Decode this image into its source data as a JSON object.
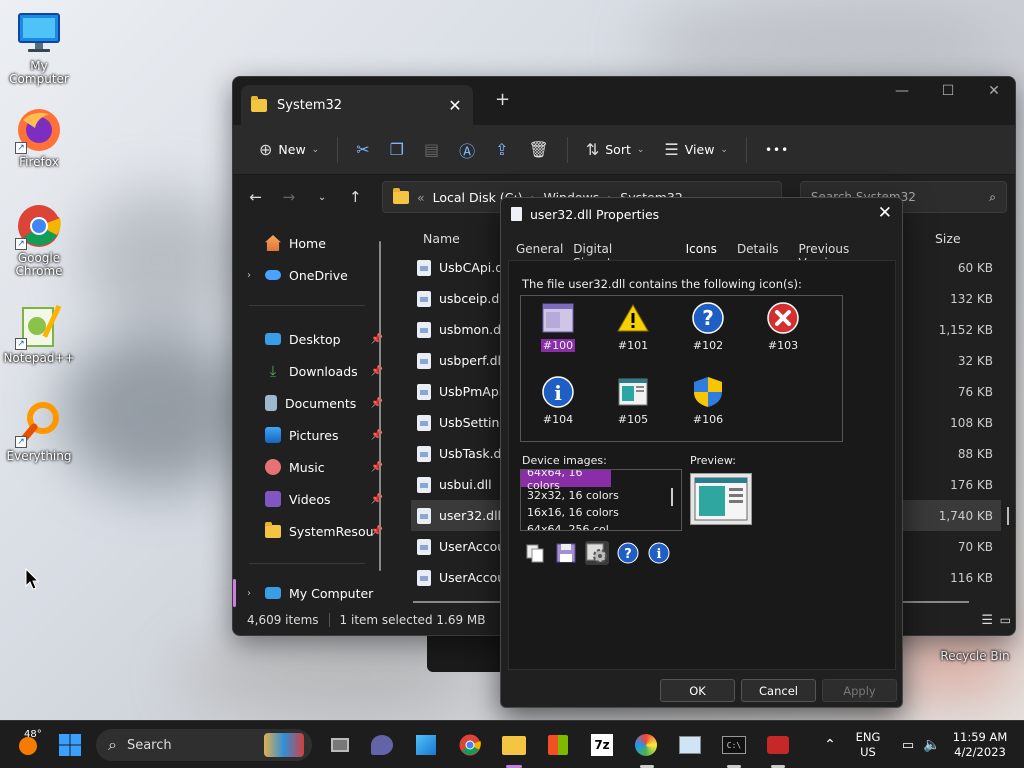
{
  "desktop": {
    "icons": [
      {
        "label": "My Computer"
      },
      {
        "label": "Firefox"
      },
      {
        "label": "Google Chrome"
      },
      {
        "label": "Notepad++"
      },
      {
        "label": "Everything"
      },
      {
        "label": "Recycle Bin"
      }
    ]
  },
  "explorer": {
    "tab_title": "System32",
    "toolbar": {
      "new": "New",
      "sort": "Sort",
      "view": "View",
      "more": "•••"
    },
    "address": {
      "segments": [
        "Local Disk (C:)",
        "Windows",
        "System32"
      ],
      "sep": "›"
    },
    "search_placeholder": "Search System32",
    "sidebar": {
      "home": "Home",
      "onedrive": "OneDrive",
      "quick": [
        "Desktop",
        "Downloads",
        "Documents",
        "Pictures",
        "Music",
        "Videos",
        "SystemResou"
      ],
      "mycomputer": "My Computer"
    },
    "columns": {
      "name": "Name",
      "size": "Size"
    },
    "files": [
      {
        "name": "UsbCApi.dll",
        "size": "60 KB"
      },
      {
        "name": "usbceip.dll",
        "size": "132 KB"
      },
      {
        "name": "usbmon.dll",
        "size": "1,152 KB"
      },
      {
        "name": "usbperf.dll",
        "size": "32 KB"
      },
      {
        "name": "UsbPmApi.dll",
        "size": "76 KB"
      },
      {
        "name": "UsbSettingsH",
        "size": "108 KB"
      },
      {
        "name": "UsbTask.dll",
        "size": "88 KB"
      },
      {
        "name": "usbui.dll",
        "size": "176 KB"
      },
      {
        "name": "user32.dll",
        "size": "1,740 KB"
      },
      {
        "name": "UserAccount",
        "size": "70 KB"
      },
      {
        "name": "UserAccount",
        "size": "116 KB"
      }
    ],
    "status": {
      "count": "4,609 items",
      "selection": "1 item selected  1.69 MB"
    }
  },
  "dialog": {
    "title": "user32.dll Properties",
    "tabs": [
      "General",
      "Digital Signatures",
      "Icons",
      "Details",
      "Previous Versions"
    ],
    "description": "The file user32.dll contains the following icon(s):",
    "icons": [
      {
        "label": "#100",
        "icon": "window-app-icon"
      },
      {
        "label": "#101",
        "icon": "warning-icon"
      },
      {
        "label": "#102",
        "icon": "question-icon"
      },
      {
        "label": "#103",
        "icon": "error-icon"
      },
      {
        "label": "#104",
        "icon": "info-icon"
      },
      {
        "label": "#105",
        "icon": "app-window-icon"
      },
      {
        "label": "#106",
        "icon": "shield-icon"
      }
    ],
    "device_images_label": "Device images:",
    "device_images": [
      "64x64, 16 colors",
      "32x32, 16 colors",
      "16x16, 16 colors",
      "64x64, 256 col"
    ],
    "preview_label": "Preview:",
    "buttons": {
      "ok": "OK",
      "cancel": "Cancel",
      "apply": "Apply"
    }
  },
  "taskbar": {
    "weather_temp": "48°",
    "search": "Search",
    "lang_top": "ENG",
    "lang_bottom": "US",
    "time": "11:59 AM",
    "date": "4/2/2023"
  },
  "colors": {
    "accent": "#c07ee6",
    "selection": "#8a2ea8"
  }
}
